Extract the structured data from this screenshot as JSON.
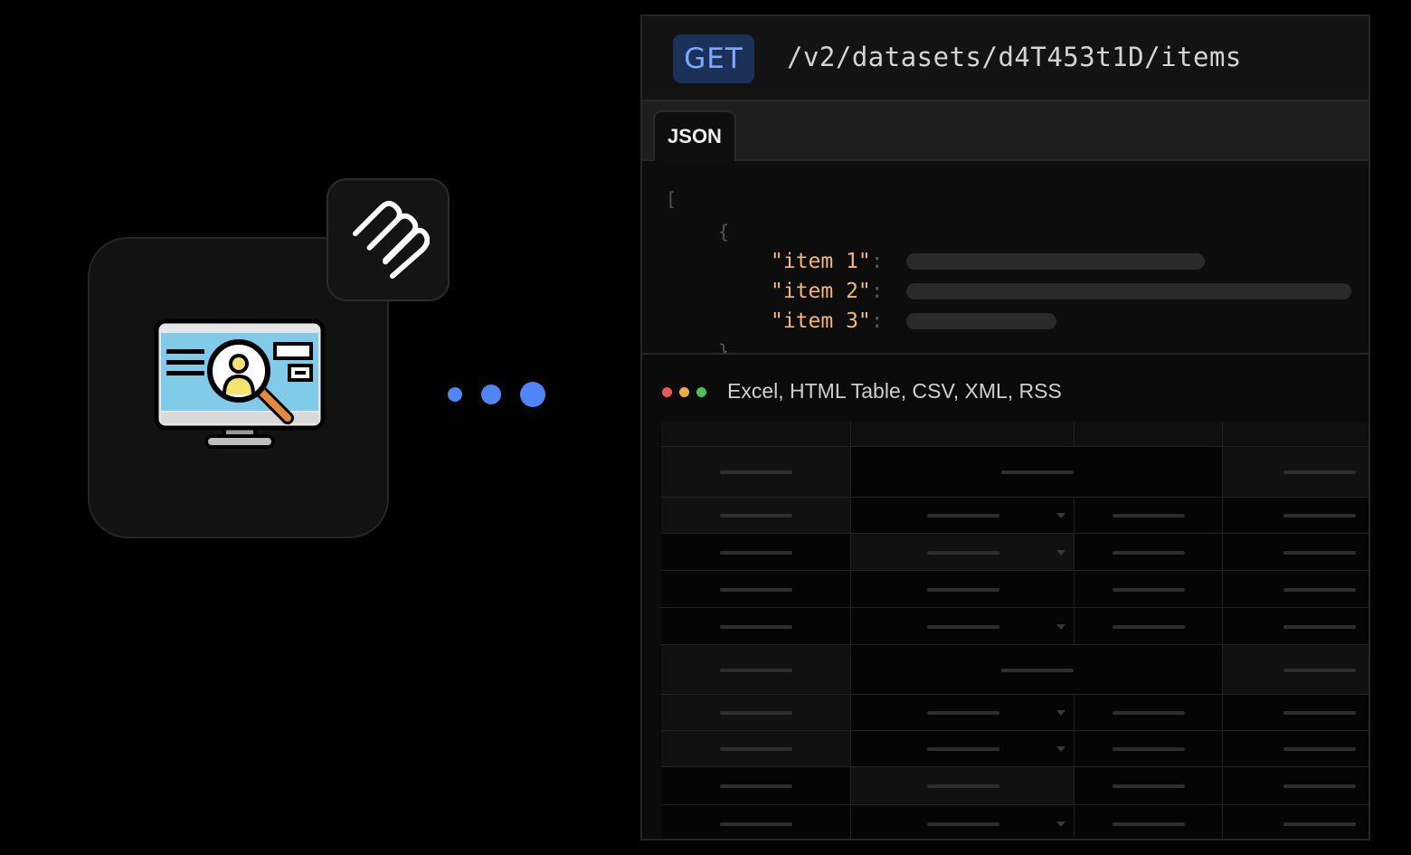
{
  "request": {
    "method": "GET",
    "endpoint": "/v2/datasets/d4T453t1D/items"
  },
  "tabs": [
    {
      "label": "JSON"
    }
  ],
  "json_preview": {
    "open_bracket": "[",
    "open_brace": "{",
    "close_brace": "}",
    "items": [
      {
        "key": "\"item 1\"",
        "colon": ":"
      },
      {
        "key": "\"item 2\"",
        "colon": ":"
      },
      {
        "key": "\"item 3\"",
        "colon": ":"
      }
    ]
  },
  "formats": {
    "label": "Excel, HTML Table, CSV, XML, RSS",
    "window_dots": [
      "#e85a4f",
      "#e8b23a",
      "#4fbf5a"
    ]
  },
  "colors": {
    "accent": "#4f86f7",
    "method_bg": "#1b3157",
    "method_text": "#7fa8ff",
    "json_key": "#f2b872"
  },
  "icons": {
    "app": "monitor-user-search-icon",
    "logo": "apify-logo-icon"
  }
}
